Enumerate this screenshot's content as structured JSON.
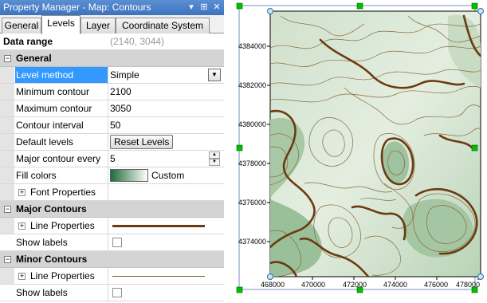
{
  "window": {
    "title": "Property Manager - Map: Contours",
    "buttons": [
      "▾",
      "⊞",
      "✕"
    ]
  },
  "tabs": [
    {
      "label": "General",
      "active": false
    },
    {
      "label": "Levels",
      "active": true
    },
    {
      "label": "Layer",
      "active": false
    },
    {
      "label": "Coordinate System",
      "active": false
    }
  ],
  "data_range": {
    "label": "Data range",
    "value": "(2140, 3044)"
  },
  "general": {
    "header": "General",
    "level_method": {
      "label": "Level method",
      "value": "Simple"
    },
    "min_contour": {
      "label": "Minimum contour",
      "value": "2100"
    },
    "max_contour": {
      "label": "Maximum contour",
      "value": "3050"
    },
    "interval": {
      "label": "Contour interval",
      "value": "50"
    },
    "default_levels": {
      "label": "Default levels",
      "button": "Reset Levels"
    },
    "major_every": {
      "label": "Major contour every",
      "value": "5"
    },
    "fill_colors": {
      "label": "Fill colors",
      "value": "Custom"
    },
    "font_properties": {
      "label": "Font Properties"
    }
  },
  "major": {
    "header": "Major Contours",
    "line_properties": "Line Properties",
    "show_labels": "Show labels",
    "line_color": "#6b3a12"
  },
  "minor": {
    "header": "Minor Contours",
    "line_properties": "Line Properties",
    "show_labels": "Show labels",
    "line_color": "#7a5a22"
  },
  "map": {
    "x_ticks": [
      "468000",
      "470000",
      "472000",
      "474000",
      "476000",
      "478000"
    ],
    "y_ticks": [
      "4384000",
      "4382000",
      "4380000",
      "4378000",
      "4376000",
      "4374000"
    ],
    "colors": {
      "fill_dark": "#7fae84",
      "fill_light": "#f2f6ee",
      "major": "#6b3a12",
      "minor": "#8a6a3a",
      "handle": "#00c000"
    }
  }
}
